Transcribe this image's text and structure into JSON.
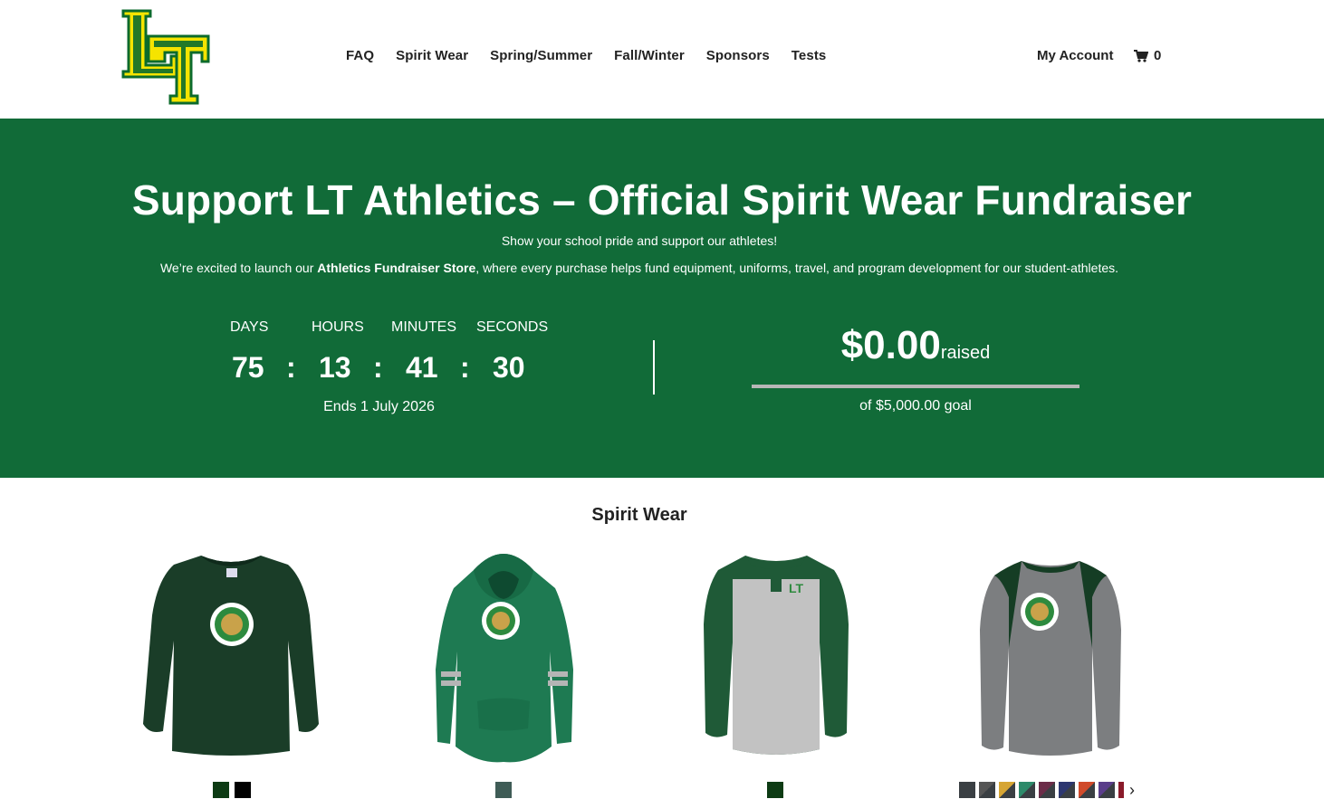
{
  "nav": {
    "items": [
      "FAQ",
      "Spirit Wear",
      "Spring/Summer",
      "Fall/Winter",
      "Sponsors",
      "Tests"
    ],
    "account": "My Account",
    "cart_count": "0"
  },
  "hero": {
    "title": "Support LT Athletics – Official Spirit Wear Fundraiser",
    "subtitle": "Show your school pride and support our athletes!",
    "desc_before": "We’re excited to launch our ",
    "desc_bold": "Athletics Fundraiser Store",
    "desc_after": ", where every purchase helps fund equipment, uniforms, travel, and program development for our student-athletes."
  },
  "countdown": {
    "labels": {
      "days": "DAYS",
      "hours": "HOURS",
      "minutes": "MINUTES",
      "seconds": "SECONDS"
    },
    "values": {
      "days": "75",
      "hours": "13",
      "minutes": "41",
      "seconds": "30"
    },
    "separator": ":",
    "ends": "Ends 1 July 2026"
  },
  "fundraiser": {
    "raised": "$0.00",
    "raised_word": "raised",
    "goal": "of $5,000.00 goal",
    "progress_fraction": 0
  },
  "section": {
    "title": "Spirit Wear"
  },
  "products": [
    {
      "icon": "long-sleeve-tee-image",
      "swatches": [
        "#0d3b14",
        "#000000"
      ]
    },
    {
      "icon": "hoodie-image",
      "swatches": [
        "#3f5c56"
      ]
    },
    {
      "icon": "henley-image",
      "swatches": [
        "#0d3b14"
      ]
    },
    {
      "icon": "raglan-tee-image",
      "swatches": [
        "#3a3f43",
        "#3a3f43",
        "#d6a533",
        "#2d8a6a",
        "#6b2c48",
        "#2d3770",
        "#d04a2a",
        "#5a3d8a",
        "#8a1a2a"
      ]
    }
  ],
  "colors": {
    "hero_green": "#116b38",
    "logo_green": "#0c6b2c",
    "logo_yellow": "#f5e400"
  }
}
